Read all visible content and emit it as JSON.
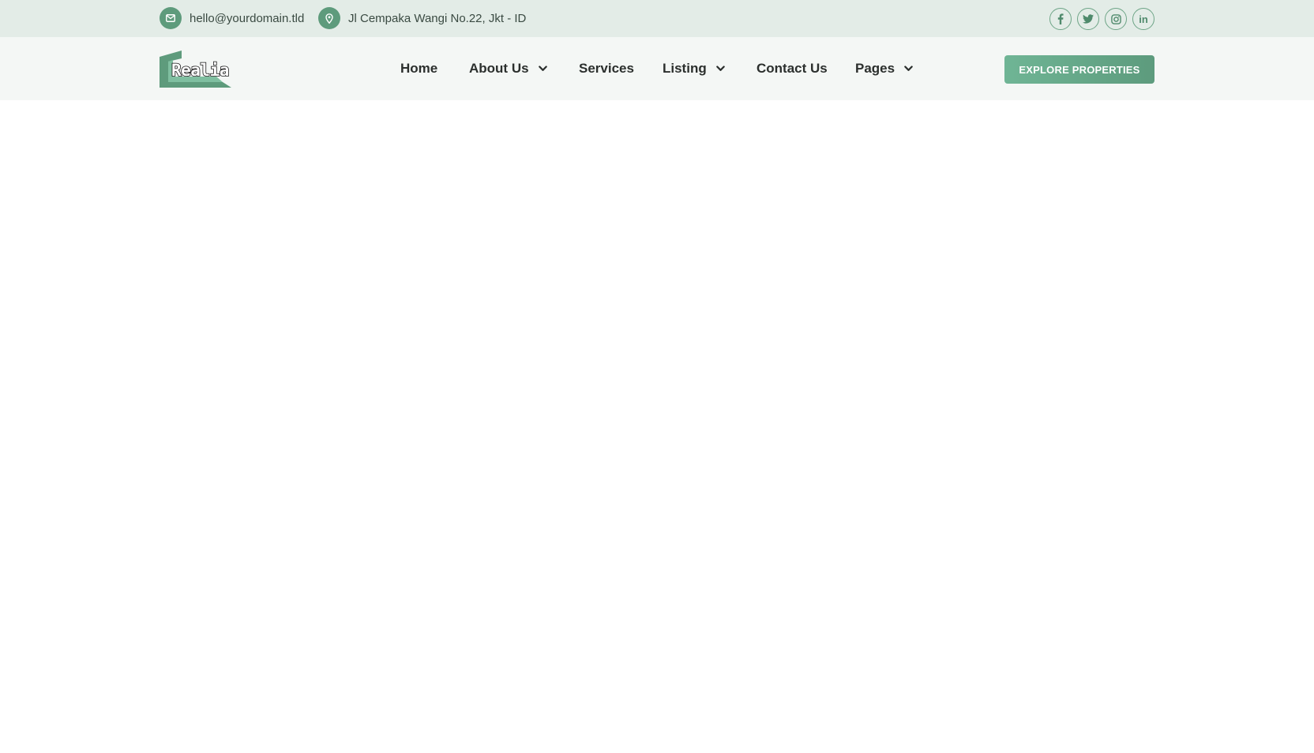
{
  "topbar": {
    "email": "hello@yourdomain.tld",
    "address": "Jl Cempaka Wangi No.22, Jkt - ID",
    "socials": [
      {
        "icon": "facebook-icon"
      },
      {
        "icon": "twitter-icon"
      },
      {
        "icon": "instagram-icon"
      },
      {
        "icon": "linkedin-icon",
        "label": "in"
      }
    ]
  },
  "header": {
    "logo_text": "Realia",
    "nav": [
      {
        "label": "Home",
        "has_dropdown": false
      },
      {
        "label": "About Us",
        "has_dropdown": true
      },
      {
        "label": "Services",
        "has_dropdown": false
      },
      {
        "label": "Listing",
        "has_dropdown": true
      },
      {
        "label": "Contact Us",
        "has_dropdown": false
      },
      {
        "label": "Pages",
        "has_dropdown": true
      }
    ],
    "cta_label": "EXPLORE PROPERTIES"
  },
  "colors": {
    "accent": "#5e9b7c",
    "topbar_bg": "#e3ece7",
    "header_bg": "#f4f7f5",
    "text_dark": "#2b2f2d"
  }
}
